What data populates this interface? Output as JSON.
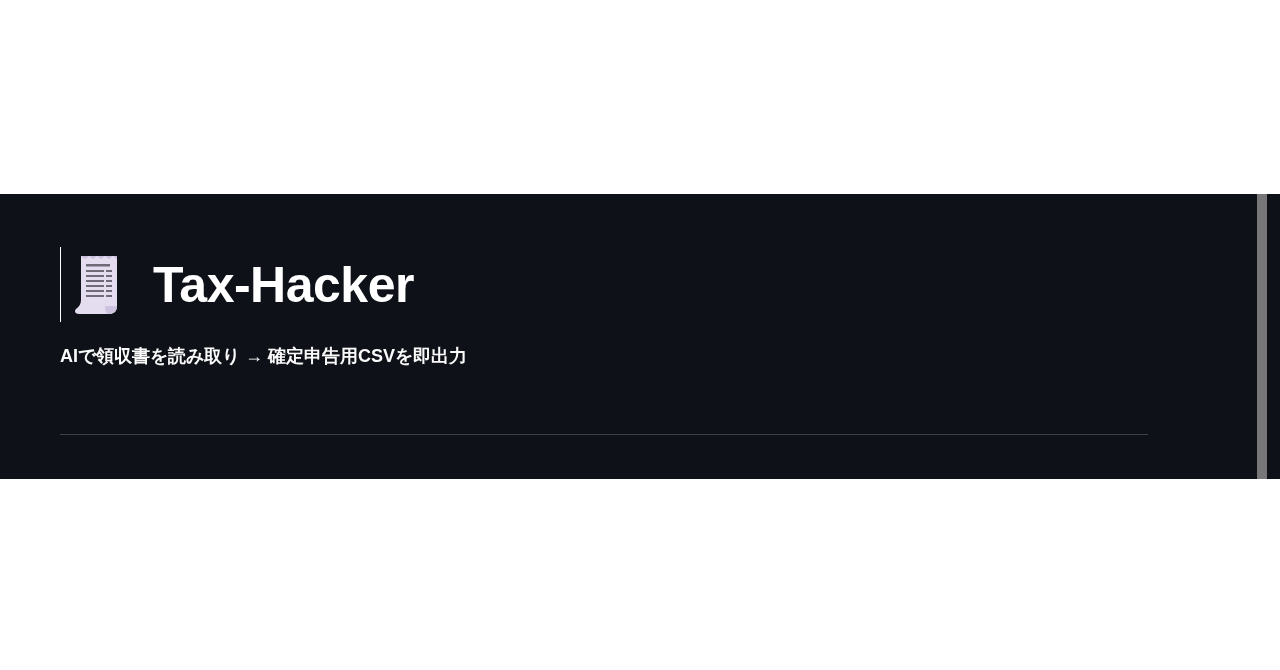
{
  "header": {
    "title": "Tax-Hacker",
    "subtitle": "AIで領収書を読み取り → 確定申告用CSVを即出力"
  }
}
